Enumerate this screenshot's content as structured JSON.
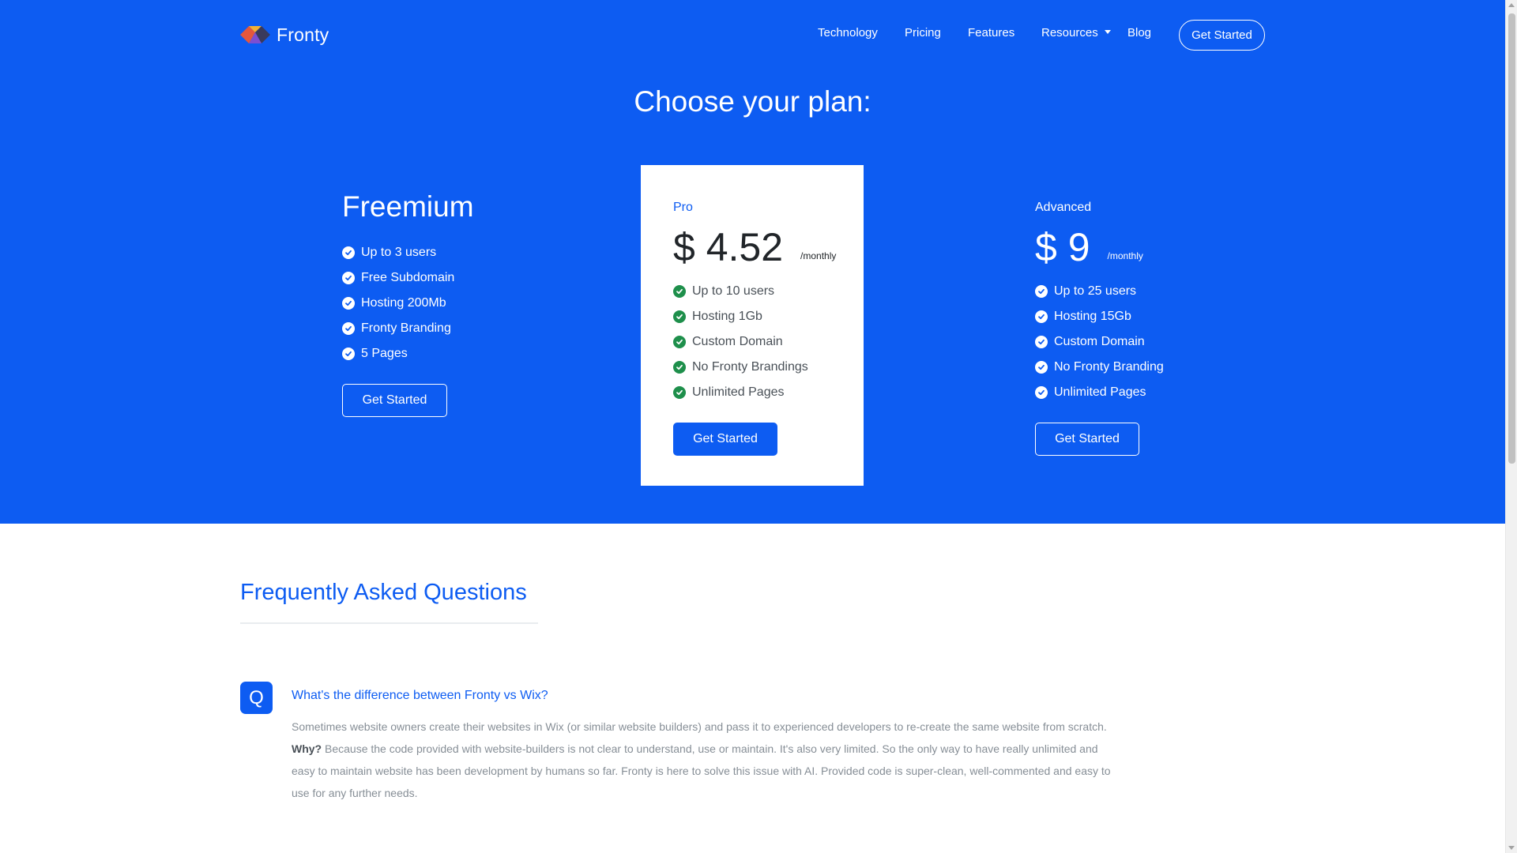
{
  "brand": {
    "name": "Fronty"
  },
  "nav": {
    "links": [
      "Technology",
      "Pricing",
      "Features",
      "Resources",
      "Blog"
    ],
    "cta": "Get Started"
  },
  "hero": {
    "title": "Choose your plan:"
  },
  "plans": [
    {
      "name": "Freemium",
      "features": [
        "Up to 3 users",
        "Free Subdomain",
        "Hosting 200Mb",
        "Fronty Branding",
        "5 Pages"
      ],
      "button": "Get Started"
    },
    {
      "name": "Pro",
      "price": "$ 4.52",
      "period": "/monthly",
      "features": [
        "Up to 10 users",
        "Hosting 1Gb",
        "Custom Domain",
        "No Fronty Brandings",
        "Unlimited Pages"
      ],
      "button": "Get Started"
    },
    {
      "name": "Advanced",
      "price": "$ 9",
      "period": "/monthly",
      "features": [
        "Up to 25 users",
        "Hosting 15Gb",
        "Custom Domain",
        "No Fronty Branding",
        "Unlimited Pages"
      ],
      "button": "Get Started"
    }
  ],
  "faq": {
    "title": "Frequently Asked Questions",
    "items": [
      {
        "badge": "Q",
        "question": "What's the difference between Fronty vs Wix?",
        "answer_intro": "Sometimes website owners create their websites in Wix (or similar website builders) and pass it to experienced developers to re-create the same website from scratch.",
        "answer_label": "Why?",
        "answer_body": "Because the code provided with website-builders is not clear to understand, use or maintain. It's also very limited. So the only way to have really unlimited and easy to maintain website has been development by humans so far. Fronty is here to solve this issue with AI. Provided code is super-clean, well-commented and easy to use for any further needs."
      }
    ]
  },
  "colors": {
    "brand_blue": "#0d5cf2",
    "check_green": "#1e8f4b",
    "muted_text": "#868e96"
  },
  "icons": {
    "logo": "fronty-logo-icon",
    "feature_check": "check-circle-icon",
    "dropdown": "caret-down-icon"
  }
}
